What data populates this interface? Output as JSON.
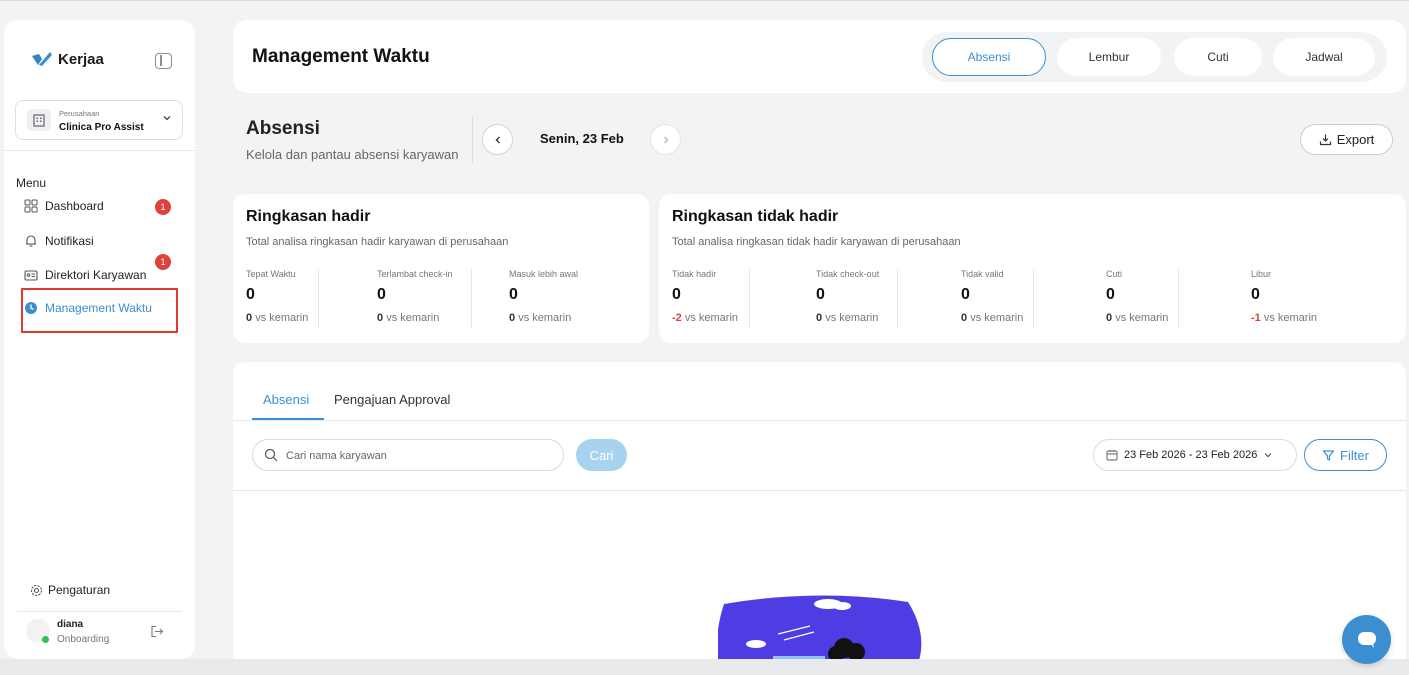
{
  "sidebar": {
    "brand": "Kerjaa",
    "company_label": "Perusahaan",
    "company_name": "Clinica Pro Assist",
    "menu_label": "Menu",
    "items": [
      {
        "label": "Dashboard",
        "icon": "grid-icon",
        "badge": "1"
      },
      {
        "label": "Notifikasi",
        "icon": "bell-icon",
        "badge": "1"
      },
      {
        "label": "Direktori Karyawan",
        "icon": "id-card-icon"
      },
      {
        "label": "Management Waktu",
        "icon": "clock-icon",
        "active": true
      }
    ],
    "settings_label": "Pengaturan",
    "user_name": "diana",
    "user_role": "Onboarding"
  },
  "header": {
    "title": "Management Waktu",
    "tabs": [
      "Absensi",
      "Lembur",
      "Cuti",
      "Jadwal"
    ],
    "active_tab": "Absensi"
  },
  "absensi": {
    "title": "Absensi",
    "subtitle": "Kelola dan pantau absensi karyawan",
    "date": "Senin, 23 Feb",
    "export_label": "Export"
  },
  "hadir": {
    "title": "Ringkasan hadir",
    "subtitle": "Total analisa ringkasan hadir karyawan di perusahaan",
    "stats": [
      {
        "label": "Tepat Waktu",
        "value": "0",
        "change": "0",
        "suffix": "vs kemarin"
      },
      {
        "label": "Terlambat check-in",
        "value": "0",
        "change": "0",
        "suffix": "vs kemarin"
      },
      {
        "label": "Masuk lebih awal",
        "value": "0",
        "change": "0",
        "suffix": "vs kemarin"
      }
    ]
  },
  "tidak_hadir": {
    "title": "Ringkasan tidak hadir",
    "subtitle": "Total analisa ringkasan tidak hadir karyawan di perusahaan",
    "stats": [
      {
        "label": "Tidak hadir",
        "value": "0",
        "change": "-2",
        "suffix": "vs kemarin"
      },
      {
        "label": "Tidak check-out",
        "value": "0",
        "change": "0",
        "suffix": "vs kemarin"
      },
      {
        "label": "Tidak valid",
        "value": "0",
        "change": "0",
        "suffix": "vs kemarin"
      },
      {
        "label": "Cuti",
        "value": "0",
        "change": "0",
        "suffix": "vs kemarin"
      },
      {
        "label": "Libur",
        "value": "0",
        "change": "-1",
        "suffix": "vs kemarin"
      }
    ]
  },
  "list": {
    "tabs": [
      "Absensi",
      "Pengajuan Approval"
    ],
    "search_placeholder": "Cari nama karyawan",
    "search_button": "Cari",
    "date_range": "23 Feb 2026 - 23 Feb 2026",
    "filter_label": "Filter"
  },
  "colors": {
    "accent": "#3b8fd0",
    "badge": "#e0413c",
    "negative": "#e0413c",
    "online": "#2fc157",
    "highlight": "#e03a32"
  }
}
